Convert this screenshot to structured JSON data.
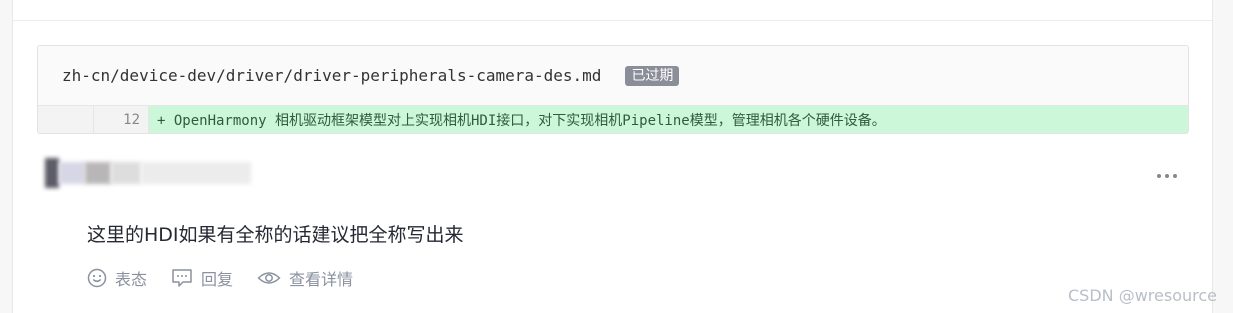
{
  "diff": {
    "file_path": "zh-cn/device-dev/driver/driver-peripherals-camera-des.md",
    "badge": "已过期",
    "line_number": "12",
    "line_text": "+ OpenHarmony 相机驱动框架模型对上实现相机HDI接口，对下实现相机Pipeline模型，管理相机各个硬件设备。"
  },
  "comment": {
    "text": "这里的HDI如果有全称的话建议把全称写出来"
  },
  "actions": {
    "react_label": "表态",
    "reply_label": "回复",
    "details_label": "查看详情"
  },
  "watermark": "CSDN @wresource",
  "colors": {
    "diff_added_bg": "#ccf7d9",
    "badge_bg": "#8a8e99"
  },
  "icons": [
    "smile-icon",
    "comment-icon",
    "eye-icon",
    "more-icon"
  ]
}
